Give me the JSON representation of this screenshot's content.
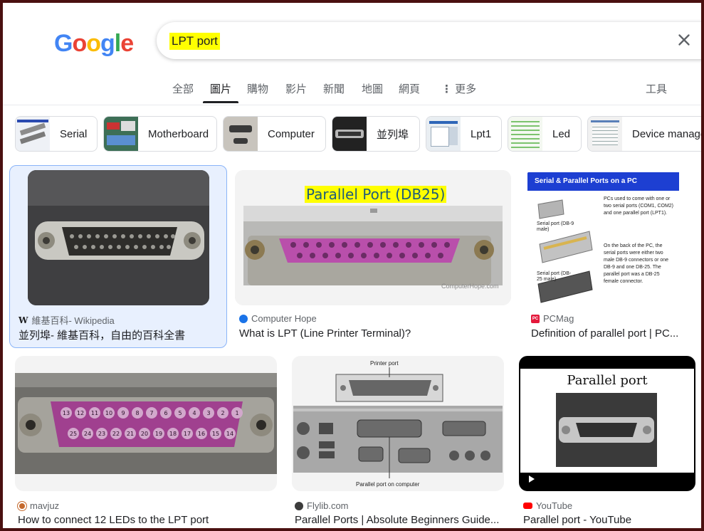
{
  "search": {
    "query": "LPT port"
  },
  "logo": {
    "letters": [
      "G",
      "o",
      "o",
      "g",
      "l",
      "e"
    ],
    "colors": [
      "#4285f4",
      "#ea4335",
      "#fbbc05",
      "#4285f4",
      "#34a853",
      "#ea4335"
    ]
  },
  "tabs": [
    {
      "label": "全部"
    },
    {
      "label": "圖片",
      "active": true
    },
    {
      "label": "購物"
    },
    {
      "label": "影片"
    },
    {
      "label": "新聞"
    },
    {
      "label": "地圖"
    },
    {
      "label": "網頁"
    },
    {
      "label": "更多"
    }
  ],
  "tools_label": "工具",
  "chips": [
    {
      "label": "Serial"
    },
    {
      "label": "Motherboard"
    },
    {
      "label": "Computer"
    },
    {
      "label": "並列埠"
    },
    {
      "label": "Lpt1"
    },
    {
      "label": "Led"
    },
    {
      "label": "Device manager"
    }
  ],
  "results": [
    {
      "source": "維基百科- Wikipedia",
      "title": "並列埠- 維基百科，自由的百科全書",
      "favicon": "W"
    },
    {
      "source": "Computer Hope",
      "title": "What is LPT (Line Printer Terminal)?",
      "image_text": "Parallel Port (DB25)",
      "watermark": "ComputerHope.com"
    },
    {
      "source": "PCMag",
      "title": "Definition of parallel port | PC...",
      "favicon": "PC",
      "image_text": {
        "header": "Serial & Parallel Ports on a PC",
        "body": "PCs used to come with one or two serial ports (COM1, COM2) and one parallel port (LPT1).",
        "body2": "On the back of the PC, the serial ports were either two male DB-9 connectors or one DB-9 and one DB-25. The parallel port was a DB-25 female connector.",
        "lbl1": "Serial port (DB-9 male)",
        "lbl2": "Serial port (DB-25 male)"
      }
    },
    {
      "source": "mavjuz",
      "title": "How to connect 12 LEDs to the LPT port",
      "pins_top": [
        "13",
        "12",
        "11",
        "10",
        "9",
        "8",
        "7",
        "6",
        "5",
        "4",
        "3",
        "2",
        "1"
      ],
      "pins_bottom": [
        "25",
        "24",
        "23",
        "22",
        "21",
        "20",
        "19",
        "18",
        "17",
        "16",
        "15",
        "14"
      ]
    },
    {
      "source": "Flylib.com",
      "title": "Parallel Ports | Absolute Beginners Guide...",
      "image_text": {
        "top": "Printer port",
        "bottom": "Parallel port on computer"
      }
    },
    {
      "source": "YouTube",
      "title": "Parallel port - YouTube",
      "image_text": "Parallel port"
    }
  ]
}
